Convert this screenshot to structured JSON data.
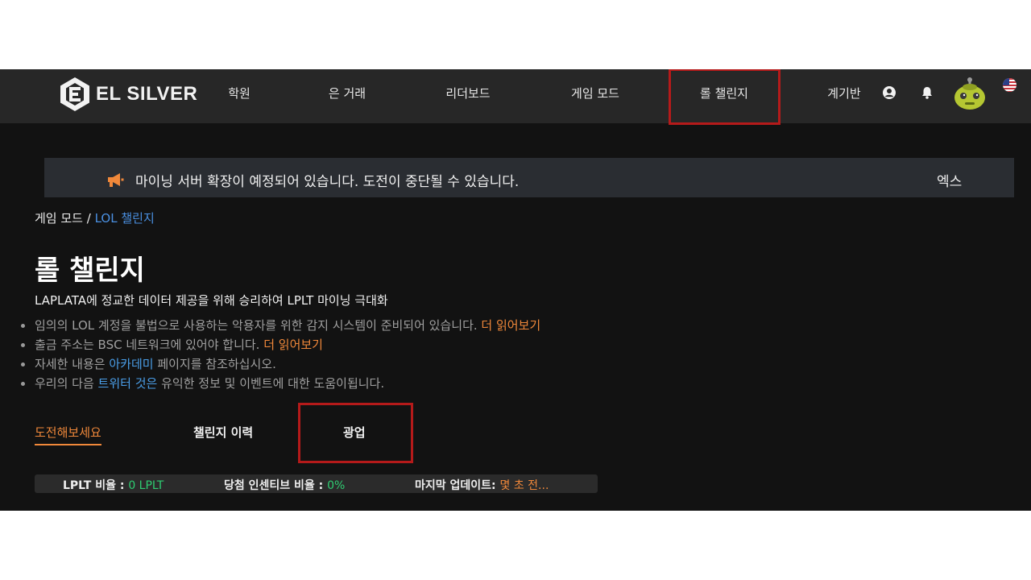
{
  "brand": {
    "name": "EL SILVER"
  },
  "nav": {
    "items": [
      {
        "label": "학원"
      },
      {
        "label": "은 거래"
      },
      {
        "label": "리더보드"
      },
      {
        "label": "게임 모드"
      },
      {
        "label": "롤 챌린지"
      },
      {
        "label": "계기반"
      }
    ],
    "active_index": 4
  },
  "header_icons": [
    "account-circle-icon",
    "bell-icon",
    "avatar",
    "us-flag-icon"
  ],
  "announcement": {
    "icon": "megaphone-icon",
    "text": "마이닝 서버 확장이 예정되어 있습니다. 도전이 중단될 수 있습니다.",
    "close_label": "엑스"
  },
  "breadcrumb": {
    "parent": "게임 모드",
    "separator": "/",
    "current": "LOL 챌린지"
  },
  "page": {
    "title": "롤 챌린지",
    "subtitle": "LAPLATA에 정교한 데이터 제공을 위해 승리하여 LPLT 마이닝 극대화"
  },
  "notes": [
    {
      "text": "임의의 LOL 계정을 불법으로 사용하는 악용자를 위한 감지 시스템이 준비되어 있습니다. ",
      "link": "더 읽어보기"
    },
    {
      "text": "출금 주소는 BSC 네트워크에 있어야 합니다. ",
      "link": "더 읽어보기"
    },
    {
      "pre": "자세한 내용은 ",
      "link": "아카데미",
      "post": " 페이지를 참조하십시오."
    },
    {
      "pre": "우리의 다음 ",
      "link": "트위터 것은",
      "post": " 유익한 정보 및 이벤트에 대한 도움이됩니다."
    }
  ],
  "tabs": [
    {
      "label": "도전해보세요",
      "active": true
    },
    {
      "label": "챌린지 이력",
      "active": false
    },
    {
      "label": "광업",
      "active": false
    }
  ],
  "stats": {
    "lplt_rate_label": "LPLT 비율 :",
    "lplt_rate_value": "0 LPLT",
    "incentive_label": "당첨 인센티브 비율 :",
    "incentive_value": "0%",
    "updated_label": "마지막 업데이트:",
    "updated_value": "몇 초 전..."
  },
  "colors": {
    "accent_orange": "#f0883a",
    "link_blue": "#4a9ee8",
    "value_green": "#2ecc71",
    "highlight_red": "#b51a1a",
    "background": "#121212",
    "header": "#272727"
  }
}
